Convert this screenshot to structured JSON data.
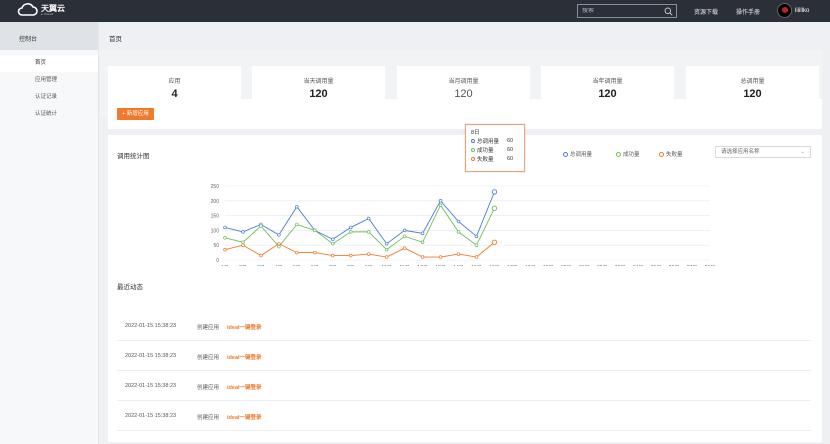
{
  "topbar": {
    "logo_cn": "天翼云",
    "logo_en": "e Cloud",
    "search_placeholder": "搜索",
    "links": [
      "资源下载",
      "操作手册"
    ],
    "username": "lilillko"
  },
  "sidebar": {
    "header": "控制台",
    "items": [
      {
        "label": "首页",
        "active": true
      },
      {
        "label": "应用管理",
        "active": false
      },
      {
        "label": "认证记录",
        "active": false
      },
      {
        "label": "认证统计",
        "active": false
      }
    ]
  },
  "page_title": "首页",
  "stats": [
    {
      "label": "应用",
      "value": "4"
    },
    {
      "label": "当天调用量",
      "value": "120"
    },
    {
      "label": "当月调用量",
      "value": "120"
    },
    {
      "label": "当年调用量",
      "value": "120"
    },
    {
      "label": "总调用量",
      "value": "120"
    }
  ],
  "add_button": "+ 新增应用",
  "chart_panel": {
    "title": "调用统计图",
    "select_placeholder": "请选择应用名称",
    "tooltip": {
      "title": "8日",
      "rows": [
        {
          "name": "总调用量",
          "value": "60"
        },
        {
          "name": "成功量",
          "value": "60"
        },
        {
          "name": "失败量",
          "value": "60"
        }
      ]
    }
  },
  "chart_data": {
    "type": "line",
    "x": [
      "1日",
      "2日",
      "3日",
      "4日",
      "5日",
      "6日",
      "7日",
      "8日",
      "9日",
      "10日",
      "11日",
      "12日",
      "13日",
      "14日",
      "15日",
      "16日",
      "17日",
      "18日",
      "19日",
      "20日",
      "21日",
      "22日",
      "23日",
      "24日",
      "25日",
      "26日",
      "27日",
      "28日"
    ],
    "ylim": [
      0,
      250
    ],
    "yticks": [
      0,
      50,
      100,
      150,
      200,
      250
    ],
    "series": [
      {
        "name": "总调用量",
        "color": "#4a7fd6",
        "values": [
          110,
          95,
          120,
          85,
          180,
          100,
          70,
          110,
          140,
          55,
          100,
          90,
          200,
          130,
          80,
          230
        ]
      },
      {
        "name": "成功量",
        "color": "#6cbf5b",
        "values": [
          75,
          60,
          115,
          45,
          120,
          100,
          55,
          95,
          95,
          35,
          80,
          60,
          185,
          95,
          50,
          175
        ]
      },
      {
        "name": "失败量",
        "color": "#f07a2b",
        "values": [
          35,
          50,
          15,
          55,
          25,
          25,
          15,
          15,
          20,
          10,
          40,
          10,
          10,
          20,
          10,
          60
        ]
      }
    ],
    "legend_position": "top-right",
    "grid": true
  },
  "activity": {
    "title": "最近动态",
    "rows": [
      {
        "time": "2022-01-15  15:38:23",
        "action": "创建应用",
        "target": "ideal一键登录"
      },
      {
        "time": "2022-01-15  15:38:23",
        "action": "创建应用",
        "target": "ideal一键登录"
      },
      {
        "time": "2022-01-15  15:38:23",
        "action": "创建应用",
        "target": "ideal一键登录"
      },
      {
        "time": "2022-01-15  15:38:23",
        "action": "创建应用",
        "target": "ideal一键登录"
      }
    ]
  }
}
